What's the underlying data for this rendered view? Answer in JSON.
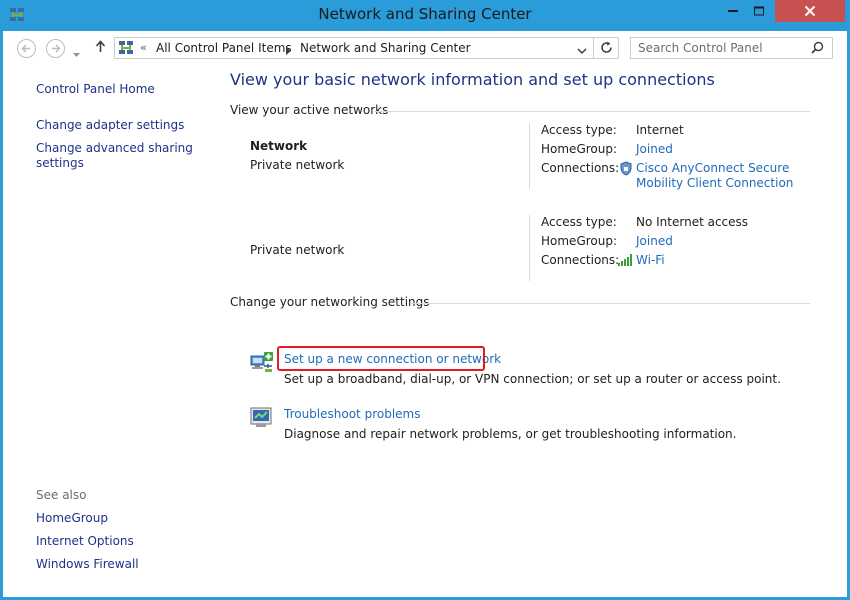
{
  "window": {
    "title": "Network and Sharing Center",
    "accent_color": "#2a9cd9",
    "close_color": "#c75050"
  },
  "toolbar": {
    "back_icon": "arrow-left-icon",
    "forward_icon": "arrow-right-icon",
    "up_icon": "arrow-up-icon",
    "breadcrumb_prefix": "«",
    "breadcrumb": [
      "All Control Panel Items",
      "Network and Sharing Center"
    ],
    "search_placeholder": "Search Control Panel"
  },
  "left_pane": {
    "home": "Control Panel Home",
    "adapter": "Change adapter settings",
    "advanced": "Change advanced sharing settings",
    "see_also": "See also",
    "see_also_links": [
      "HomeGroup",
      "Internet Options",
      "Windows Firewall"
    ]
  },
  "main": {
    "heading": "View your basic network information and set up connections",
    "active_section": "View your active networks",
    "labels": {
      "access_type": "Access type:",
      "homegroup": "HomeGroup:",
      "connections": "Connections:"
    },
    "networks": [
      {
        "name": "Network",
        "type": "Private network",
        "access_type": "Internet",
        "homegroup": "Joined",
        "connection": "Cisco AnyConnect Secure Mobility Client Connection",
        "connection_icon": "vpn-icon"
      },
      {
        "name": "",
        "type": "Private network",
        "access_type": "No Internet access",
        "homegroup": "Joined",
        "connection": "Wi-Fi",
        "connection_icon": "wifi-signal-icon"
      }
    ],
    "settings_section": "Change your networking settings",
    "tasks": [
      {
        "title": "Set up a new connection or network",
        "description": "Set up a broadband, dial-up, or VPN connection; or set up a router or access point.",
        "icon": "new-connection-icon"
      },
      {
        "title": "Troubleshoot problems",
        "description": "Diagnose and repair network problems, or get troubleshooting information.",
        "icon": "troubleshoot-icon"
      }
    ],
    "highlight_color": "#e11b22",
    "link_color": "#1e6bb8",
    "nav_link_color": "#1e3287"
  }
}
